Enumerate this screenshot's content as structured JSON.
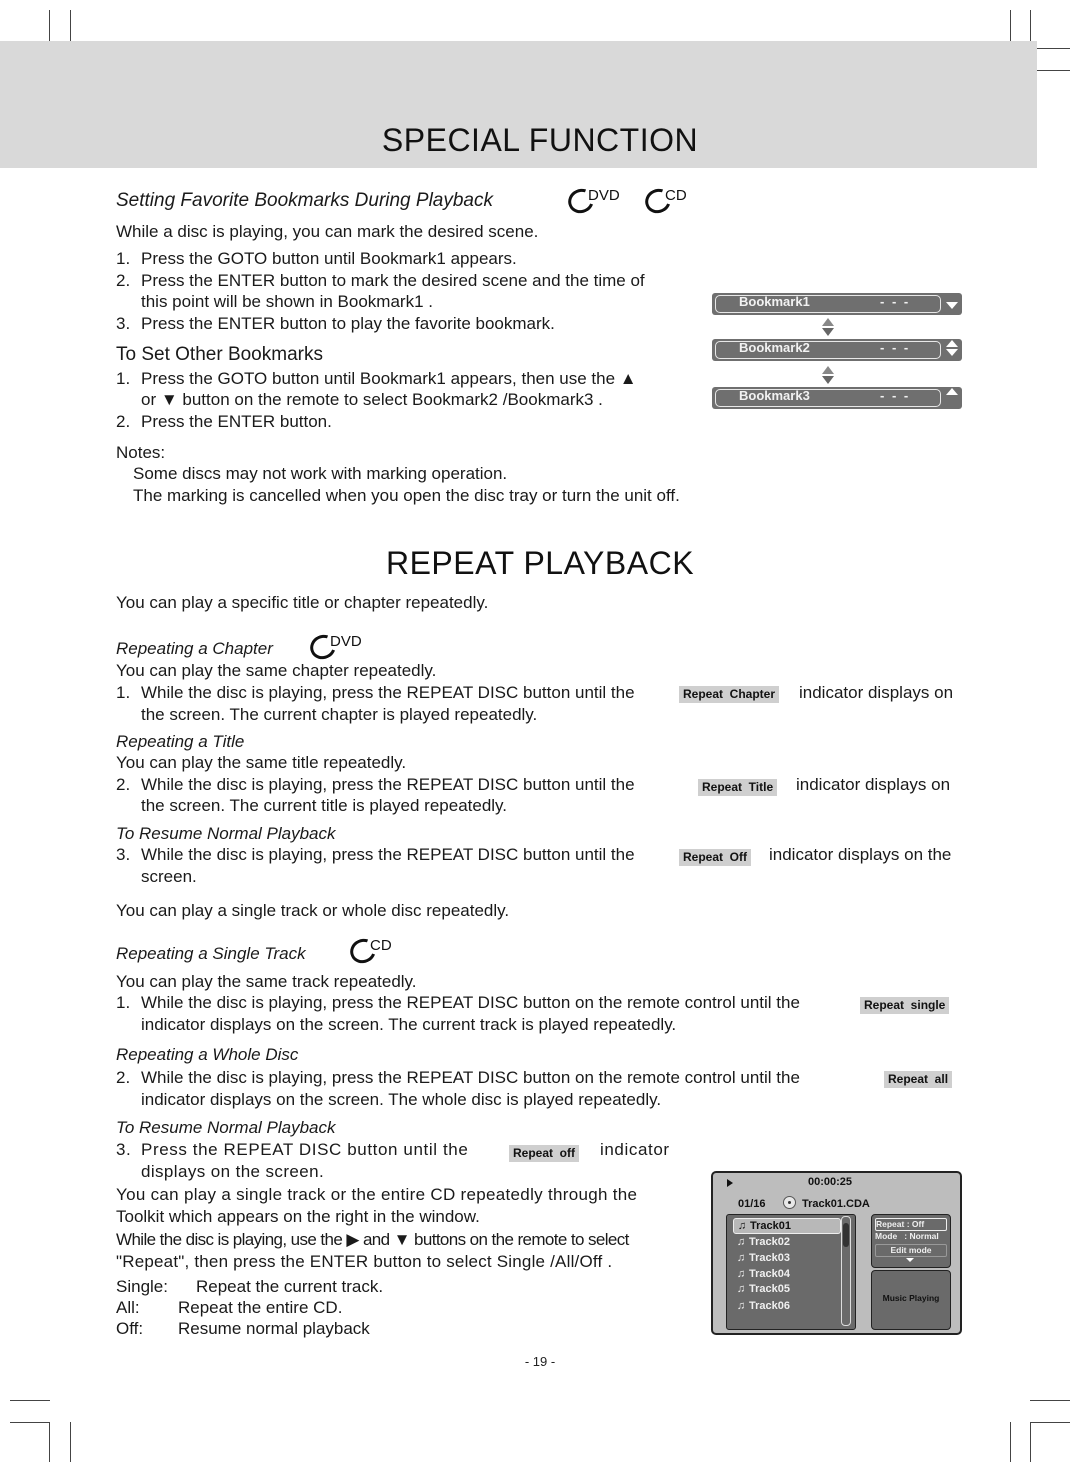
{
  "special_function": {
    "title": "SPECIAL FUNCTION",
    "bookmarks": {
      "heading": "Setting Favorite Bookmarks During Playback",
      "logos": [
        "DVD",
        "CD"
      ],
      "intro": "While a disc is playing, you can mark the desired scene.",
      "steps": [
        {
          "num": "1.",
          "text": "Press the GOTO button until Bookmark1   appears."
        },
        {
          "num": "2.",
          "text": "Press the ENTER button to mark the desired scene and the time of",
          "cont": "this point will be shown in Bookmark1  ."
        },
        {
          "num": "3.",
          "text": "Press the ENTER button to play the favorite bookmark."
        }
      ],
      "other_heading": "To Set Other Bookmarks",
      "other_steps": [
        {
          "num": "1.",
          "text": "Press the GOTO button until Bookmark1   appears, then use the ▲",
          "cont": "or ▼ button on the remote to select Bookmark2 /Bookmark3 ."
        },
        {
          "num": "2.",
          "text": "Press the ENTER button."
        }
      ],
      "notes_label": "Notes:",
      "notes": [
        "Some discs may not work with marking operation.",
        "The marking is cancelled when you open the disc tray or turn the unit off."
      ],
      "osd": [
        {
          "label": "Bookmark1",
          "value": "- - -",
          "arrows": "down"
        },
        {
          "label": "Bookmark2",
          "value": "- - -",
          "arrows": "up-down"
        },
        {
          "label": "Bookmark3",
          "value": "- - -",
          "arrows": "up"
        }
      ]
    }
  },
  "repeat_playback": {
    "title": "REPEAT PLAYBACK",
    "intro": "You can play a specific title or chapter repeatedly.",
    "chapter": {
      "heading": "Repeating a Chapter",
      "logo": "DVD",
      "desc": "You can play the same chapter repeatedly.",
      "num": "1.",
      "pre": "While the disc is playing, press the REPEAT DISC button until the",
      "badge": "Repeat  Chapter",
      "post": "indicator displays on",
      "cont": "the screen. The current chapter is played repeatedly."
    },
    "title_repeat": {
      "heading": "Repeating a Title",
      "desc": "You can play the same title repeatedly.",
      "num": "2.",
      "pre": "While the disc is playing, press the REPEAT DISC button until the",
      "badge": "Repeat  Title",
      "post": "indicator displays on",
      "cont": "the screen. The current title is played repeatedly."
    },
    "resume_dvd": {
      "heading": "To Resume Normal Playback",
      "num": "3.",
      "pre": "While the disc is playing, press the REPEAT DISC button until the",
      "badge": "Repeat  Off",
      "post": "indicator displays on the",
      "cont": "screen."
    },
    "cd_intro": "You can play a single track or whole disc repeatedly.",
    "single": {
      "heading": "Repeating a Single Track",
      "logo": "CD",
      "desc": "You can play the same track repeatedly.",
      "num": "1.",
      "pre": "While the disc is playing, press the REPEAT DISC button on the remote control until the",
      "badge": "Repeat  single",
      "cont": "indicator displays on the screen. The current track is played repeatedly."
    },
    "whole": {
      "heading": "Repeating a Whole Disc",
      "num": "2.",
      "pre": "While the disc is playing, press the REPEAT DISC button on the remote control until the",
      "badge": "Repeat  all",
      "cont": "indicator displays on the screen. The whole disc is played repeatedly."
    },
    "resume_cd": {
      "heading": "To Resume Normal Playback",
      "num": "3.",
      "pre": "Press the REPEAT DISC button until the",
      "badge": "Repeat  off",
      "post": "indicator",
      "cont": "displays on the screen."
    },
    "toolkit": {
      "line1": "You can play a single track or the entire CD repeatedly through the",
      "line2": "Toolkit which appears on the right in the window.",
      "line3": "While the disc is playing, use the ▶ and ▼ buttons on the remote to select",
      "line4": "\"Repeat\", then press the ENTER button to select Single /All/Off ."
    },
    "options": [
      {
        "key": "Single:",
        "desc": "Repeat the current track."
      },
      {
        "key": "All:",
        "desc": "Repeat the entire CD."
      },
      {
        "key": "Off:",
        "desc": "Resume normal playback"
      }
    ],
    "cd_screen": {
      "time": "00:00:25",
      "count": "01/16",
      "file": "Track01.CDA",
      "tracks": [
        "Track01",
        "Track02",
        "Track03",
        "Track04",
        "Track05",
        "Track06"
      ],
      "selected_track": "Track01",
      "repeat": "Repeat : Off",
      "mode": "Mode   : Normal",
      "edit": "Edit mode",
      "status": "Music Playing"
    }
  },
  "footer": {
    "page": "- 19 -"
  }
}
